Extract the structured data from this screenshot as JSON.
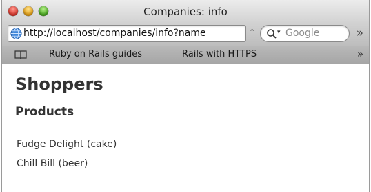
{
  "window": {
    "title": "Companies: info"
  },
  "toolbar": {
    "url": "http://localhost/companies/info?name",
    "search_placeholder": "Google",
    "icons": [
      "globe-icon",
      "reload-icon",
      "search-icon",
      "overflow-icon"
    ]
  },
  "bookmarks": {
    "items": [
      {
        "label": "Ruby on Rails guides"
      },
      {
        "label": "Rails with HTTPS"
      }
    ]
  },
  "page": {
    "title": "Shoppers",
    "section_heading": "Products",
    "products": [
      {
        "label": "Fudge Delight (cake)"
      },
      {
        "label": "Chill Bill (beer)"
      }
    ]
  },
  "colors": {
    "close": "#d8342a",
    "minimize": "#e09a10",
    "zoom": "#45a51c",
    "heading_text": "#333333"
  }
}
